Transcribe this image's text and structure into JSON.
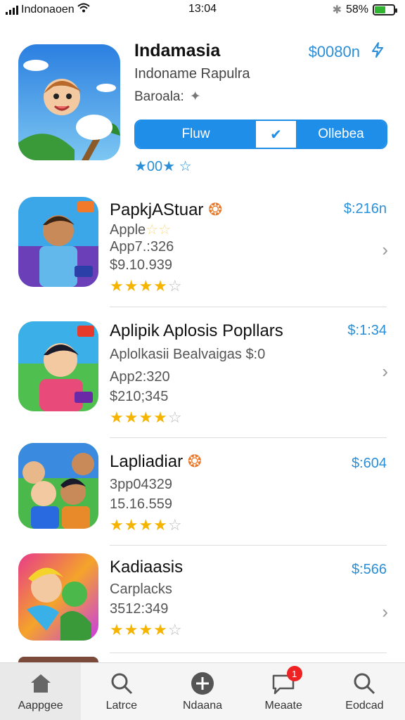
{
  "status": {
    "carrier": "Indonaoen",
    "time": "13:04",
    "battery": "58%",
    "battery_level": 0.58
  },
  "hero": {
    "title": "Indamasia",
    "subtitle": "Indoname Rapulra",
    "meta": "Baroala:",
    "price": "$0080n",
    "segment_left": "Fluw",
    "segment_right": "Ollebea",
    "rating_text": "0",
    "stars": "★00★ ☆"
  },
  "apps": [
    {
      "title": "PapkjAStuar",
      "line1": "Apple",
      "line2": "App7.:326",
      "line3": "$9.10.939",
      "price": "$:216n",
      "rating": 4
    },
    {
      "title": "Aplipik Aplosis Popllars",
      "line1": "Aplolkasii  Bealvaigas $:0",
      "line2": "App2:320",
      "line3": "$210;345",
      "price": "$:1:34",
      "rating": 4
    },
    {
      "title": "Lapliadiar",
      "line1": "",
      "line2": "3pp04329",
      "line3": "15.16.559",
      "price": "$:604",
      "rating": 4
    },
    {
      "title": "Kadiaasis",
      "line1": "Carplacks",
      "line2": "",
      "line3": "3512:349",
      "price": "$:566",
      "rating": 4
    }
  ],
  "tabs": [
    {
      "label": "Aappgee",
      "icon": "home-icon"
    },
    {
      "label": "Latrce",
      "icon": "search-icon"
    },
    {
      "label": "Ndaana",
      "icon": "plus-circle-icon"
    },
    {
      "label": "Meaate",
      "icon": "message-icon",
      "badge": "1"
    },
    {
      "label": "Eodcad",
      "icon": "search-icon"
    }
  ],
  "colors": {
    "accent": "#1f8ee8",
    "price": "#2a8fd8",
    "star": "#f4b400"
  }
}
